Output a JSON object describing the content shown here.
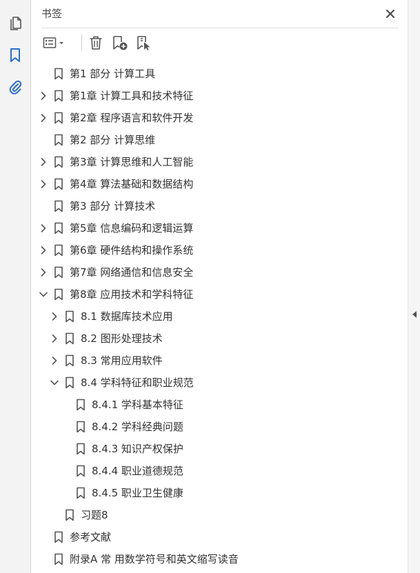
{
  "panel": {
    "title": "书签"
  },
  "colors": {
    "accent": "#2a6ecf",
    "icon": "#555555",
    "text": "#333333"
  },
  "rail": {
    "items": [
      {
        "icon": "page-thumbnails-icon",
        "active": false
      },
      {
        "icon": "bookmark-icon",
        "active": true
      },
      {
        "icon": "attachment-icon",
        "active": false
      }
    ]
  },
  "toolbar": {
    "buttons": [
      "options-menu",
      "delete-bookmark",
      "new-bookmark",
      "new-bookmark-from-structure"
    ]
  },
  "bookmarks": [
    {
      "label": "第1 部分 计算工具",
      "level": 0,
      "expander": "none"
    },
    {
      "label": "第1章 计算工具和技术特征",
      "level": 0,
      "expander": "collapsed"
    },
    {
      "label": "第2章 程序语言和软件开发",
      "level": 0,
      "expander": "collapsed"
    },
    {
      "label": "第2 部分 计算思维",
      "level": 0,
      "expander": "none"
    },
    {
      "label": "第3章 计算思维和人工智能",
      "level": 0,
      "expander": "collapsed"
    },
    {
      "label": "第4章 算法基础和数据结构",
      "level": 0,
      "expander": "collapsed"
    },
    {
      "label": "第3 部分 计算技术",
      "level": 0,
      "expander": "none"
    },
    {
      "label": "第5章 信息编码和逻辑运算",
      "level": 0,
      "expander": "collapsed"
    },
    {
      "label": "第6章 硬件结构和操作系统",
      "level": 0,
      "expander": "collapsed"
    },
    {
      "label": "第7章 网络通信和信息安全",
      "level": 0,
      "expander": "collapsed"
    },
    {
      "label": "第8章 应用技术和学科特征",
      "level": 0,
      "expander": "expanded"
    },
    {
      "label": "8.1 数据库技术应用",
      "level": 1,
      "expander": "collapsed"
    },
    {
      "label": "8.2 图形处理技术",
      "level": 1,
      "expander": "collapsed"
    },
    {
      "label": "8.3 常用应用软件",
      "level": 1,
      "expander": "collapsed"
    },
    {
      "label": "8.4 学科特征和职业规范",
      "level": 1,
      "expander": "expanded"
    },
    {
      "label": "8.4.1 学科基本特征",
      "level": 2,
      "expander": "none"
    },
    {
      "label": "8.4.2 学科经典问题",
      "level": 2,
      "expander": "none"
    },
    {
      "label": "8.4.3 知识产权保护",
      "level": 2,
      "expander": "none"
    },
    {
      "label": "8.4.4 职业道德规范",
      "level": 2,
      "expander": "none"
    },
    {
      "label": "8.4.5 职业卫生健康",
      "level": 2,
      "expander": "none"
    },
    {
      "label": "习题8",
      "level": 1,
      "expander": "none"
    },
    {
      "label": "参考文献",
      "level": 0,
      "expander": "none"
    },
    {
      "label": "附录A 常 用数学符号和英文缩写读音",
      "level": 0,
      "expander": "none"
    }
  ]
}
